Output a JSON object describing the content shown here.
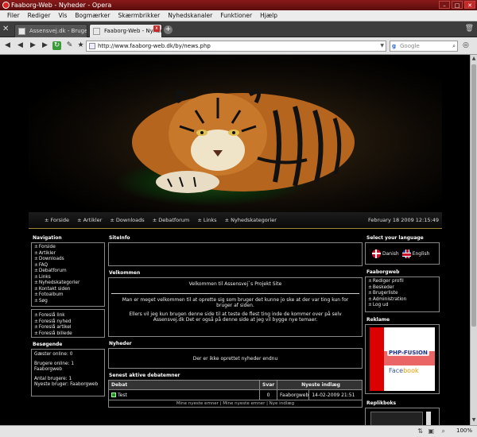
{
  "window": {
    "title": "Faaborg-Web - Nyheder - Opera"
  },
  "menu": [
    "Filer",
    "Rediger",
    "Vis",
    "Bogmærker",
    "Skærmbrikker",
    "Nyhedskanaler",
    "Funktioner",
    "Hjælp"
  ],
  "tabs": [
    {
      "label": "Assensvej.dk - Brugerp...",
      "active": false
    },
    {
      "label": "Faaborg-Web - Nyheder",
      "active": true
    }
  ],
  "address": {
    "url": "http://www.faaborg-web.dk/by/news.php",
    "search_placeholder": "Google"
  },
  "site": {
    "nav_links": [
      "Forside",
      "Artikler",
      "Downloads",
      "Debatforum",
      "Links",
      "Nyhedskategorier"
    ],
    "date": "February 18 2009 12:15:49"
  },
  "navigation": {
    "title": "Navigation",
    "items": [
      "Forside",
      "Artikler",
      "Downloads",
      "FAQ",
      "Debatforum",
      "Links",
      "Nyhedskategorier",
      "Kontakt siden",
      "Fotoalbum",
      "Søg"
    ],
    "suggest_items": [
      "Foreslå link",
      "Foreslå nyhed",
      "Foreslå artikel",
      "Foreslå billede"
    ]
  },
  "visitors": {
    "title": "Besøgende",
    "guests": "Gæster online: 0",
    "users_online": "Brugere online: 1",
    "user_name": "Faaborgweb",
    "total_users": "Antal brugere: 1",
    "newest_user": "Nyeste bruger: Faaborgweb"
  },
  "siteinfo": {
    "title": "SiteInfo"
  },
  "welcome": {
    "title": "Velkommen",
    "heading": "Velkommen til Assensvej`s Projekt Site",
    "p1": "Man er meget velkommen til at oprette sig som bruger det kunne jo ske at der var ting kun for bruger af siden.",
    "p2": "Ellers vil jeg kun brugen denne side til at teste de flest ting inde de kommer over på selv Assensvej.dk Det er også på denne side at jeg vil bygge nye temaer."
  },
  "news": {
    "title": "Nyheder",
    "empty": "Der er ikke oprettet nyheder endnu"
  },
  "debates": {
    "title": "Senest aktive debatemner",
    "columns": [
      "Debat",
      "Svar",
      "Nyeste indlæg"
    ],
    "rows": [
      {
        "topic": "Test",
        "replies": "0",
        "author": "Faaborgweb",
        "date": "14-02-2009 21:51"
      }
    ],
    "footer": "Mine nyeste emner | Mine nyeste emner | Nye indlæg"
  },
  "language": {
    "title": "Select your language",
    "danish": "Danish",
    "english": "English"
  },
  "account": {
    "title": "Faaborgweb",
    "items": [
      "Rediger profil",
      "Beskeder",
      "Brugerliste",
      "Administration",
      "Log ud"
    ]
  },
  "ad": {
    "title": "Reklame",
    "logo": "PHP-FUSION",
    "fb1": "Face",
    "fb2": "book"
  },
  "shoutbox": {
    "title": "Replikboks"
  },
  "status": {
    "zoom": "100%"
  }
}
